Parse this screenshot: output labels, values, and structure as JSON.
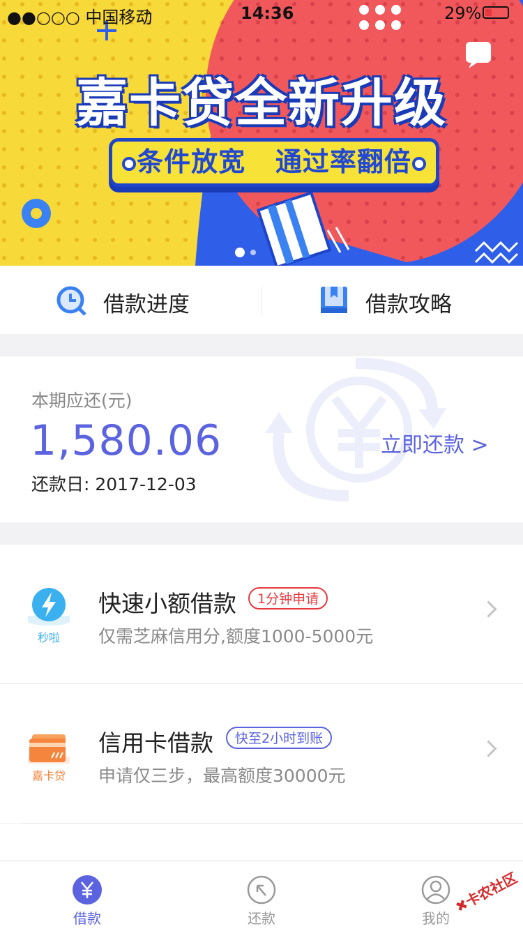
{
  "status_bar": {
    "carrier": "●●○○○ 中国移动",
    "time": "14:36",
    "battery": "29%"
  },
  "banner": {
    "headline": "嘉卡贷全新升级",
    "subline": "条件放宽   通过率翻倍"
  },
  "quick_links": [
    {
      "label": "借款进度",
      "icon": "clock-icon"
    },
    {
      "label": "借款攻略",
      "icon": "book-icon"
    }
  ],
  "repay": {
    "label": "本期应还(元)",
    "amount": "1,580.06",
    "due_date": "还款日: 2017-12-03",
    "action": "立即还款 >"
  },
  "loans": [
    {
      "title": "快速小额借款",
      "tag": "1分钟申请",
      "subtitle": "仅需芝麻信用分,额度1000-5000元",
      "icon_caption": "秒啦",
      "icon": "lightning-icon",
      "tag_color": "#e8383d"
    },
    {
      "title": "信用卡借款",
      "tag": "快至2小时到账",
      "subtitle": "申请仅三步，最高额度30000元",
      "icon_caption": "嘉卡贷",
      "icon": "card-icon",
      "tag_color": "#5b63e0"
    }
  ],
  "tabs": [
    {
      "label": "借款",
      "icon": "yen-icon",
      "active": true
    },
    {
      "label": "还款",
      "icon": "repay-arrow-icon",
      "active": false
    },
    {
      "label": "我的",
      "icon": "user-icon",
      "active": false
    }
  ],
  "watermark": "卡农社区",
  "colors": {
    "accent": "#5b63e0",
    "banner_yellow": "#f8d93a",
    "banner_red": "#f0585c",
    "banner_blue": "#2f5fe8"
  }
}
